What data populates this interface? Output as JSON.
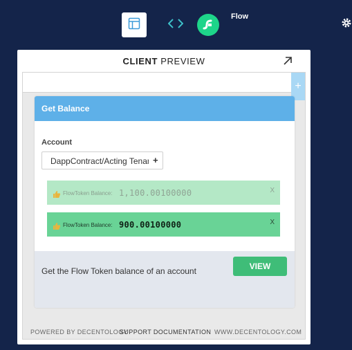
{
  "topbar": {
    "app_name": "Flow",
    "icons": [
      "layout-icon",
      "code-icon",
      "flow-logo-icon",
      "gear-icon"
    ]
  },
  "panel": {
    "title_bold": "CLIENT",
    "title_rest": " PREVIEW",
    "add_tab_label": "+",
    "card": {
      "title": "Get Balance",
      "account_label": "Account",
      "account_value": "DappContract/Acting Tenant",
      "select_icon": "+",
      "results": [
        {
          "label": "FlowToken Balance:",
          "value": "1,100.00100000",
          "close": "X"
        },
        {
          "label": "FlowToken Balance:",
          "value": "900.00100000",
          "close": "X"
        }
      ],
      "description": "Get the Flow Token balance of an account",
      "view_label": "VIEW"
    },
    "footer": {
      "powered": "POWERED BY DECENTOLOGY",
      "support": "SUPPORT DOCUMENTATION",
      "site": "WWW.DECENTOLOGY.COM"
    }
  },
  "colors": {
    "background": "#14244a",
    "card_header": "#5eb0e8",
    "flow_green": "#1ed58a",
    "view_button": "#3fbd78",
    "result_faded": "#b4e8c6",
    "result_active": "#69d396"
  }
}
